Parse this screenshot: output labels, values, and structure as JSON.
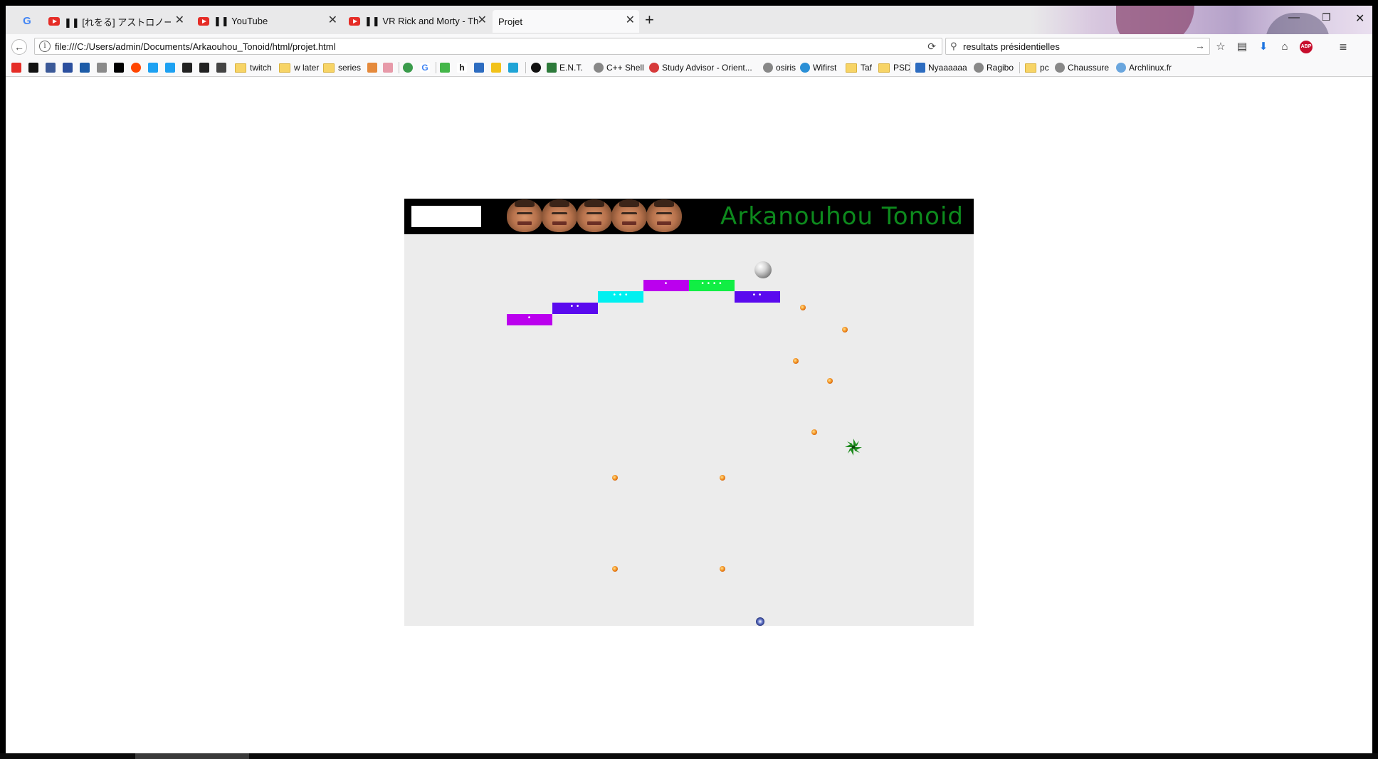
{
  "browser": {
    "tabs": [
      {
        "title": "",
        "icon": "google-icon"
      },
      {
        "title": "❚❚ [れをる] アストロノーツ【",
        "icon": "youtube-icon"
      },
      {
        "title": "❚❚ YouTube",
        "icon": "youtube-icon"
      },
      {
        "title": "❚❚ VR Rick and Morty - The F",
        "icon": "youtube-icon"
      },
      {
        "title": "Projet",
        "icon": ""
      }
    ],
    "new_tab_label": "+",
    "url": "file:///C:/Users/admin/Documents/Arkaouhou_Tonoid/html/projet.html",
    "search_query": "resultats présidentielles",
    "abp_label": "ABP"
  },
  "bookmarks": [
    {
      "label": "twitch",
      "type": "folder"
    },
    {
      "label": "w later",
      "type": "folder"
    },
    {
      "label": "series",
      "type": "folder"
    },
    {
      "label": "E.N.T.",
      "type": "link"
    },
    {
      "label": "C++ Shell",
      "type": "link"
    },
    {
      "label": "Study Advisor - Orient...",
      "type": "link"
    },
    {
      "label": "osiris",
      "type": "link"
    },
    {
      "label": "Wifirst",
      "type": "link"
    },
    {
      "label": "Taf",
      "type": "folder"
    },
    {
      "label": "PSD",
      "type": "folder"
    },
    {
      "label": "Nyaaaaaa",
      "type": "link"
    },
    {
      "label": "Ragibo",
      "type": "link"
    },
    {
      "label": "pc",
      "type": "folder"
    },
    {
      "label": "Chaussure",
      "type": "link"
    },
    {
      "label": "Archlinux.fr",
      "type": "link"
    }
  ],
  "game": {
    "title": "Arkanouhou Tonoid",
    "score": "",
    "lives": 5,
    "bricks": [
      {
        "color": "#bb00ee",
        "label": "•"
      },
      {
        "color": "#5a0aee",
        "label": "• •"
      },
      {
        "color": "#00f0f0",
        "label": "• • •"
      },
      {
        "color": "#bb00ee",
        "label": "•"
      },
      {
        "color": "#11ee44",
        "label": "• • • •"
      },
      {
        "color": "#5a0aee",
        "label": "• •"
      }
    ]
  }
}
